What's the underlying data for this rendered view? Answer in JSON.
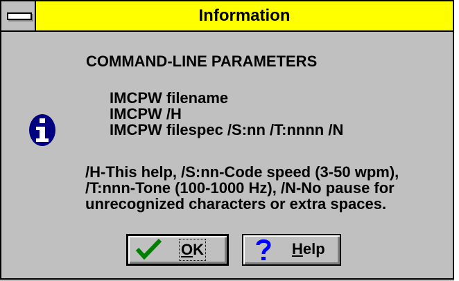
{
  "window": {
    "title": "Information"
  },
  "message": {
    "heading": "COMMAND-LINE PARAMETERS",
    "commands": [
      "IMCPW filename",
      "IMCPW /H",
      "IMCPW filespec /S:nn /T:nnnn /N"
    ],
    "description_lines": [
      "/H-This help, /S:nn-Code speed (3-50 wpm),",
      "/T:nnn-Tone (100-1000 Hz), /N-No pause for",
      "unrecognized characters or extra spaces."
    ]
  },
  "icons": {
    "system_menu": "system-menu-icon",
    "info": "info-icon",
    "ok": "checkmark-icon",
    "help": "question-mark-icon"
  },
  "buttons": {
    "ok": {
      "mnemonic": "O",
      "rest": "K"
    },
    "help": {
      "mnemonic": "H",
      "rest": "elp"
    }
  },
  "colors": {
    "titlebar": "#ffff00",
    "dialog_bg": "#c0c0c0",
    "info_icon": "#000080",
    "check": "#008000",
    "question": "#0000ff"
  }
}
